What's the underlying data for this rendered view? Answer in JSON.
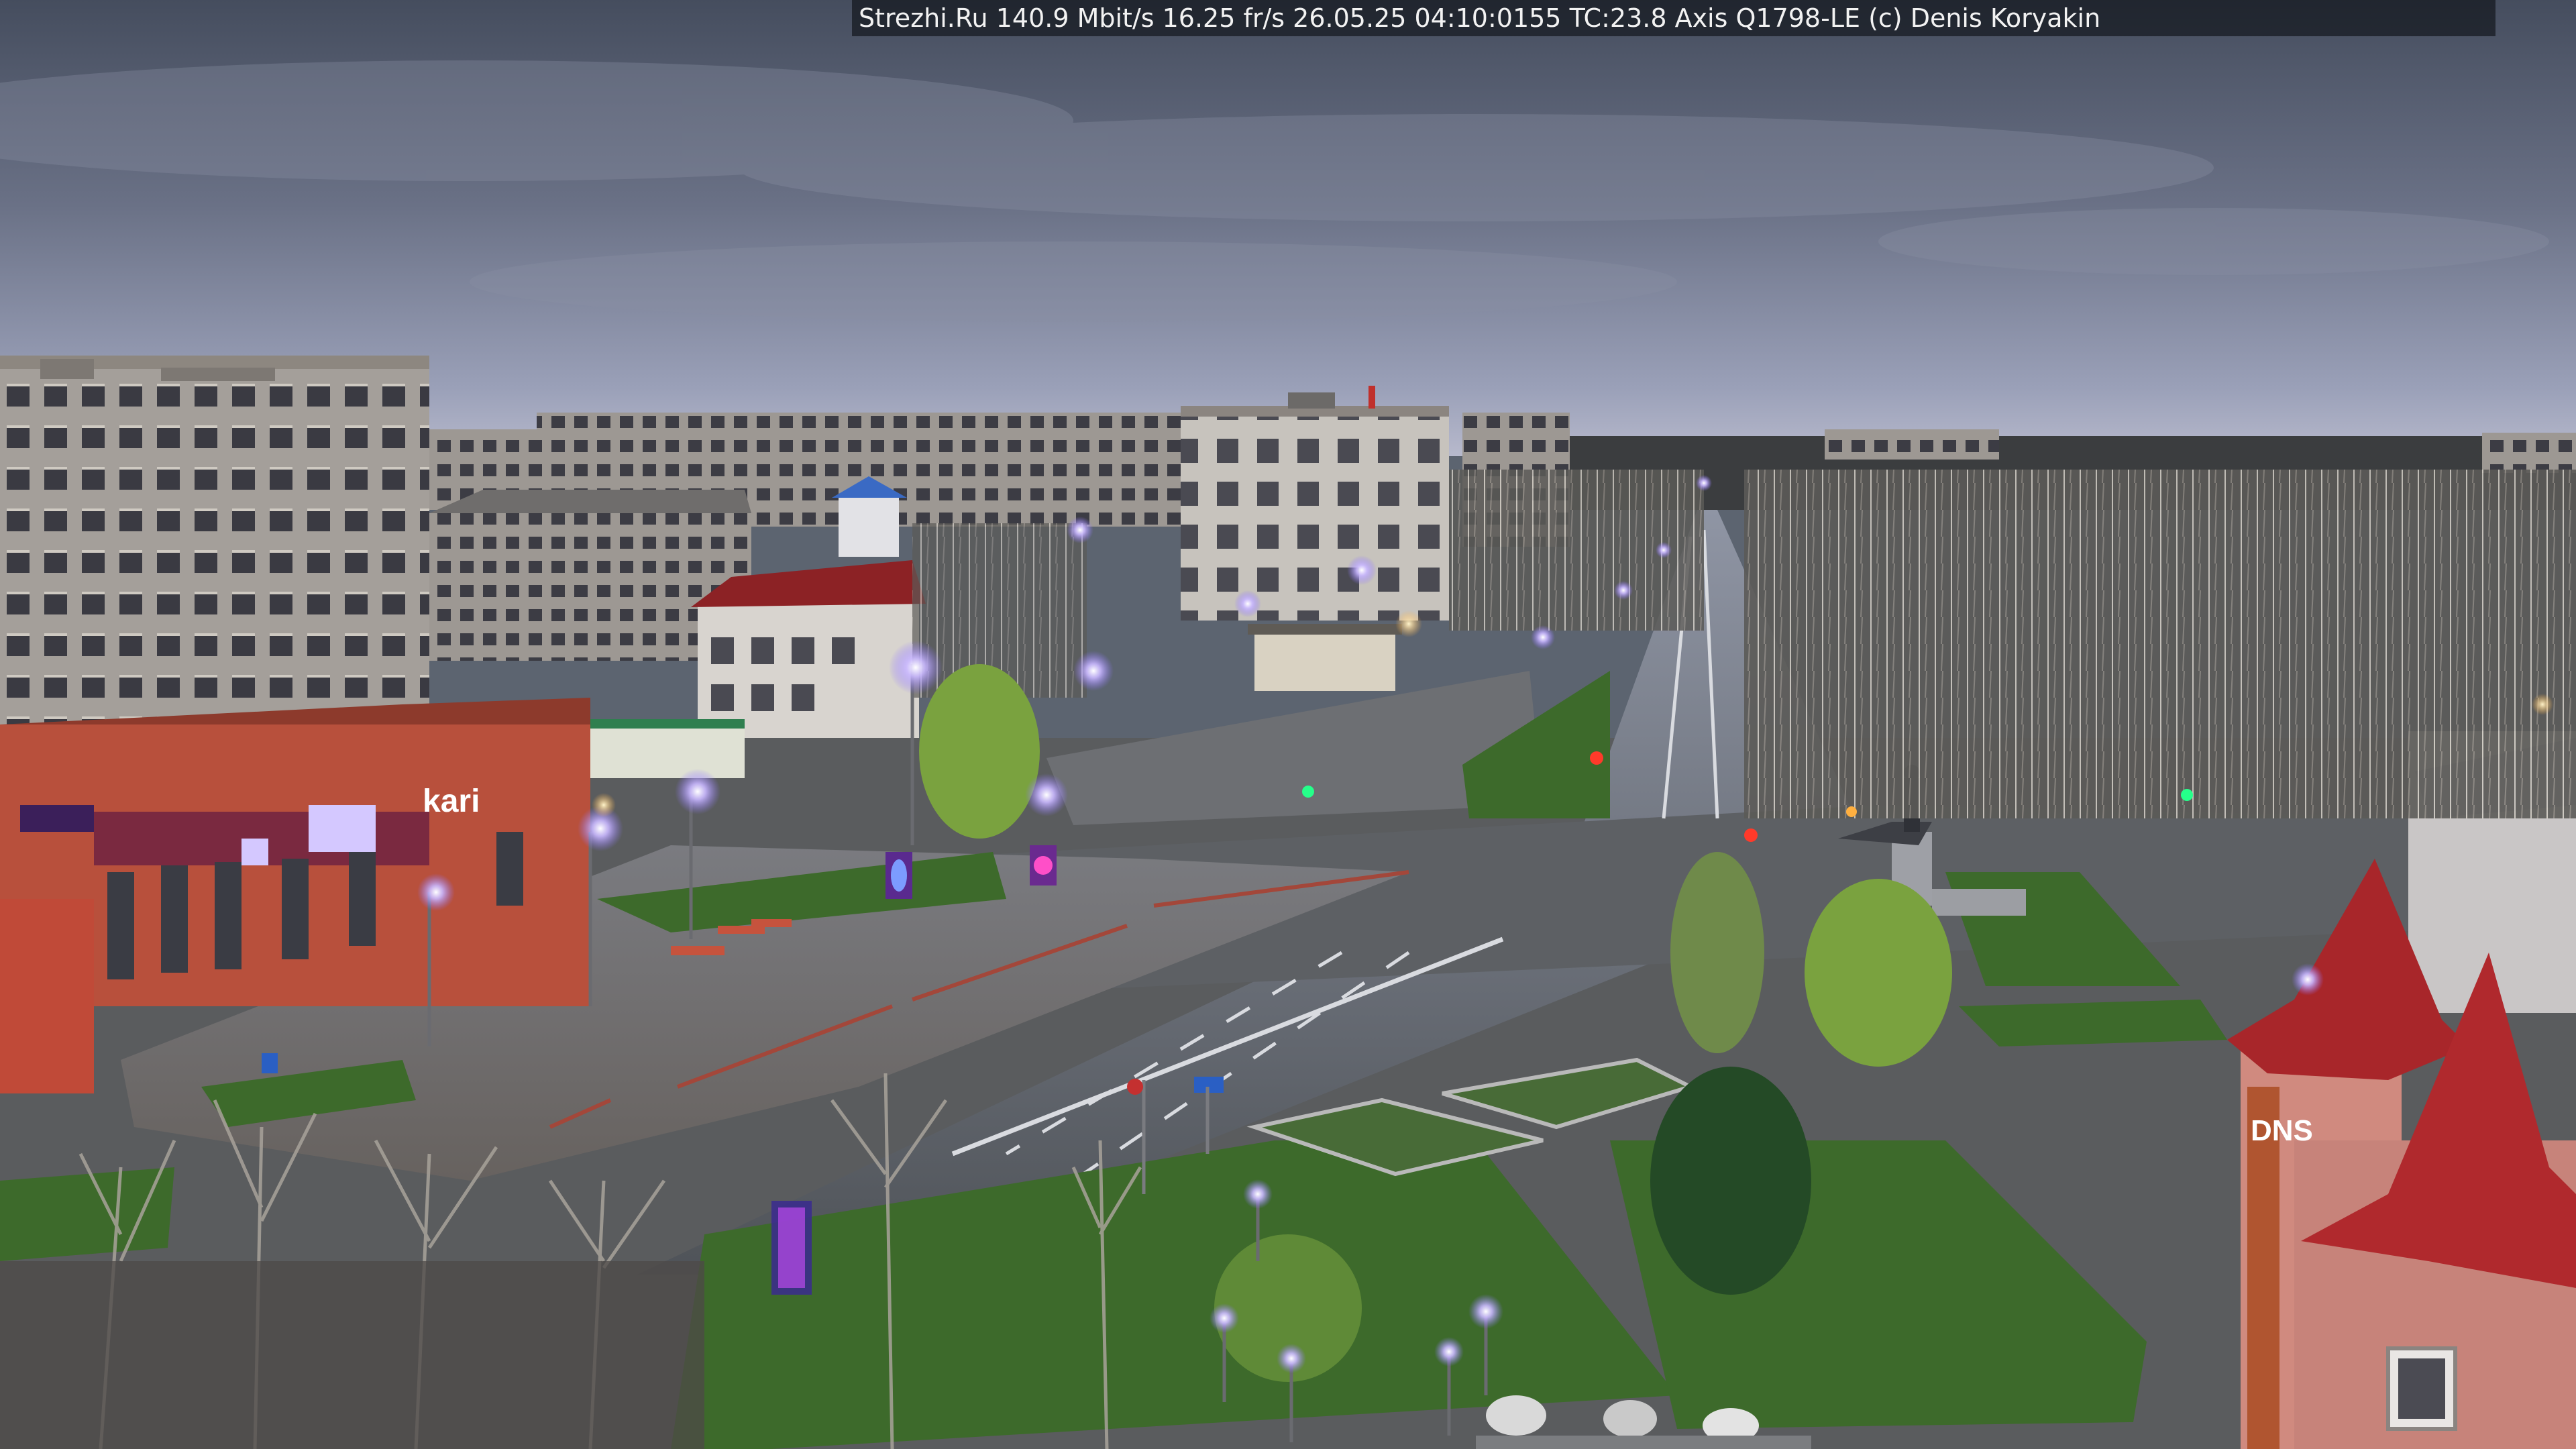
{
  "overlay": {
    "text": "Strezhi.Ru 140.9 Mbit/s 16.25 fr/s 26.05.25 04:10:0155 TC:23.8  Axis Q1798-LE  (c) Denis Koryakin"
  },
  "storefront_signs": [
    "kari",
    "DNS"
  ],
  "colors": {
    "sky_top": "#4a5263",
    "sky_horizon": "#a8aec5",
    "asphalt": "#55585c",
    "grass": "#3f6a2e",
    "brick": "#b24a38",
    "roof_red": "#a8262a",
    "street_light": "#b9a6ff"
  }
}
